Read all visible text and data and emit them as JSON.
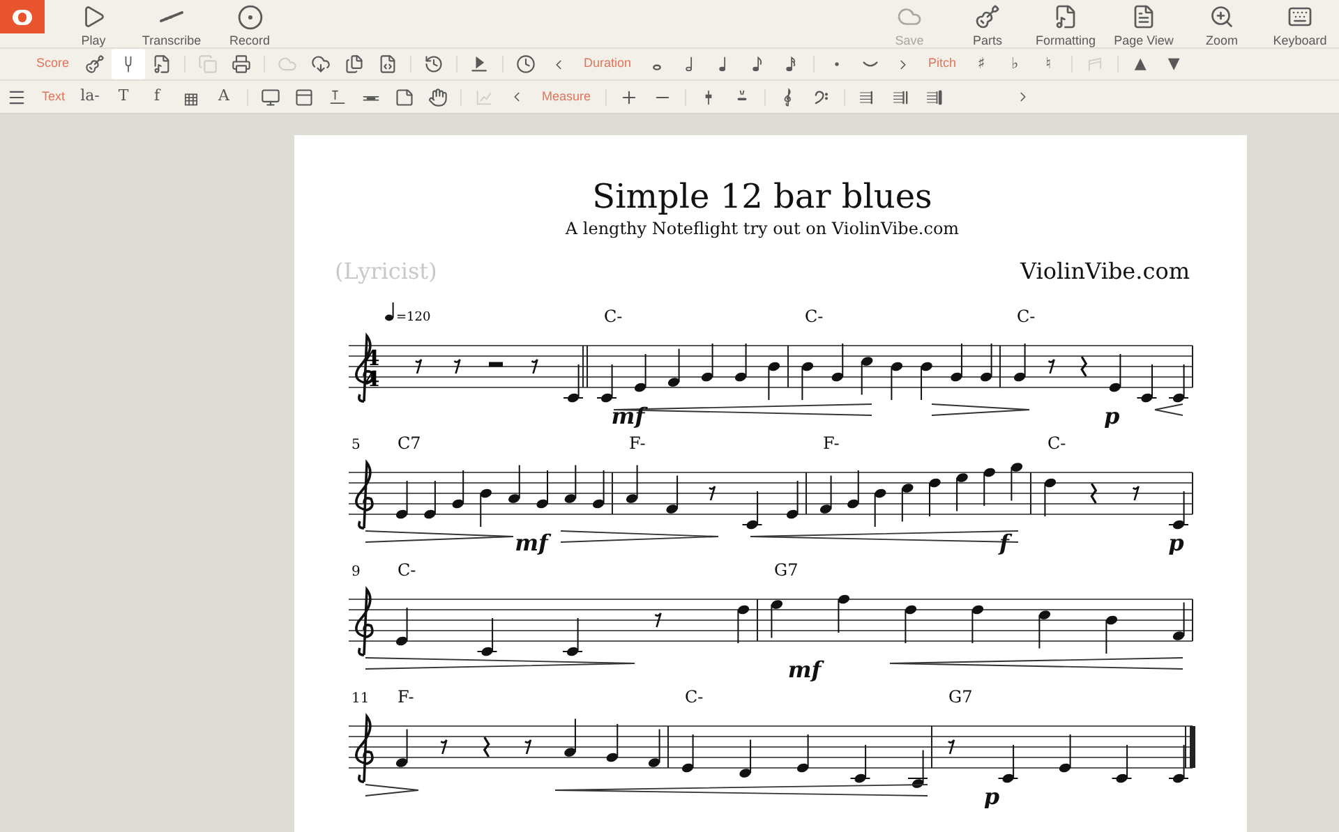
{
  "app_bar": {
    "left_items": [
      {
        "label": "Play",
        "disabled": false
      },
      {
        "label": "Transcribe",
        "disabled": false
      },
      {
        "label": "Record",
        "disabled": false
      }
    ],
    "right_items": [
      {
        "label": "Save",
        "disabled": true
      },
      {
        "label": "Parts",
        "disabled": false
      },
      {
        "label": "Formatting",
        "disabled": false
      },
      {
        "label": "Page View",
        "disabled": false
      },
      {
        "label": "Zoom",
        "disabled": false
      },
      {
        "label": "Keyboard",
        "disabled": false
      }
    ]
  },
  "toolbar_rows": [
    [
      {
        "kind": "label",
        "text": "Score"
      },
      {
        "kind": "icon",
        "selected": false,
        "disabled": false
      },
      {
        "kind": "icon",
        "selected": true,
        "disabled": false
      },
      {
        "kind": "icon",
        "selected": false,
        "disabled": false
      },
      {
        "kind": "separator"
      },
      {
        "kind": "icon",
        "selected": false,
        "disabled": true
      },
      {
        "kind": "icon",
        "selected": false,
        "disabled": false
      },
      {
        "kind": "separator"
      },
      {
        "kind": "icon",
        "selected": false,
        "disabled": true
      },
      {
        "kind": "icon",
        "selected": false,
        "disabled": false
      },
      {
        "kind": "icon",
        "selected": false,
        "disabled": false
      },
      {
        "kind": "icon",
        "selected": false,
        "disabled": false
      },
      {
        "kind": "separator"
      },
      {
        "kind": "icon",
        "selected": false,
        "disabled": false
      },
      {
        "kind": "separator"
      },
      {
        "kind": "icon",
        "selected": false,
        "disabled": false
      },
      {
        "kind": "separator"
      },
      {
        "kind": "icon",
        "selected": false,
        "disabled": false
      },
      {
        "kind": "icon",
        "selected": false,
        "disabled": false
      },
      {
        "kind": "label",
        "text": "Duration"
      },
      {
        "kind": "icon",
        "selected": false,
        "disabled": false
      },
      {
        "kind": "icon",
        "selected": false,
        "disabled": false
      },
      {
        "kind": "icon",
        "selected": false,
        "disabled": false
      },
      {
        "kind": "icon",
        "selected": false,
        "disabled": false
      },
      {
        "kind": "icon",
        "selected": false,
        "disabled": false
      },
      {
        "kind": "separator"
      },
      {
        "kind": "icon",
        "selected": false,
        "disabled": false
      },
      {
        "kind": "icon",
        "selected": false,
        "disabled": false
      },
      {
        "kind": "icon",
        "selected": false,
        "disabled": false
      },
      {
        "kind": "label",
        "text": "Pitch"
      },
      {
        "kind": "glyph",
        "text": "♯",
        "selected": false,
        "disabled": false
      },
      {
        "kind": "glyph",
        "text": "♭",
        "selected": false,
        "disabled": false
      },
      {
        "kind": "glyph",
        "text": "♮",
        "selected": false,
        "disabled": false
      },
      {
        "kind": "separator"
      },
      {
        "kind": "icon",
        "selected": false,
        "disabled": true
      },
      {
        "kind": "separator"
      },
      {
        "kind": "glyph",
        "text": "▲",
        "selected": false,
        "disabled": false
      },
      {
        "kind": "glyph",
        "text": "▼",
        "selected": false,
        "disabled": false
      }
    ],
    [
      {
        "kind": "icon",
        "selected": false,
        "disabled": false
      },
      {
        "kind": "label",
        "text": "Text"
      },
      {
        "kind": "glyph",
        "text": "la-",
        "selected": false,
        "disabled": false
      },
      {
        "kind": "glyph",
        "text": "T",
        "selected": false,
        "disabled": false
      },
      {
        "kind": "glyph",
        "text": "f",
        "selected": false,
        "disabled": false
      },
      {
        "kind": "icon",
        "selected": false,
        "disabled": false
      },
      {
        "kind": "glyph",
        "text": "A",
        "selected": false,
        "disabled": false
      },
      {
        "kind": "separator"
      },
      {
        "kind": "icon",
        "selected": false,
        "disabled": false
      },
      {
        "kind": "icon",
        "selected": false,
        "disabled": false
      },
      {
        "kind": "icon",
        "selected": false,
        "disabled": false
      },
      {
        "kind": "icon",
        "selected": false,
        "disabled": false
      },
      {
        "kind": "icon",
        "selected": false,
        "disabled": false
      },
      {
        "kind": "icon",
        "selected": false,
        "disabled": false
      },
      {
        "kind": "separator"
      },
      {
        "kind": "icon",
        "selected": false,
        "disabled": true
      },
      {
        "kind": "icon",
        "selected": false,
        "disabled": false
      },
      {
        "kind": "label",
        "text": "Measure"
      },
      {
        "kind": "separator"
      },
      {
        "kind": "icon",
        "selected": false,
        "disabled": false
      },
      {
        "kind": "icon",
        "selected": false,
        "disabled": false
      },
      {
        "kind": "separator"
      },
      {
        "kind": "icon",
        "selected": false,
        "disabled": false
      },
      {
        "kind": "icon",
        "selected": false,
        "disabled": false
      },
      {
        "kind": "separator"
      },
      {
        "kind": "icon",
        "selected": false,
        "disabled": false
      },
      {
        "kind": "icon",
        "selected": false,
        "disabled": false
      },
      {
        "kind": "separator"
      },
      {
        "kind": "icon",
        "selected": false,
        "disabled": false
      },
      {
        "kind": "icon",
        "selected": false,
        "disabled": false
      },
      {
        "kind": "icon",
        "selected": false,
        "disabled": false
      },
      {
        "kind": "spacer"
      },
      {
        "kind": "icon",
        "selected": false,
        "disabled": false
      }
    ]
  ],
  "score": {
    "title": "Simple 12 bar blues",
    "subtitle": "A lengthy Noteflight try out on ViolinVibe.com",
    "lyricist": "(Lyricist)",
    "composer": "ViolinVibe.com",
    "tempo": "=120",
    "time_signature": [
      "4",
      "4"
    ],
    "systems": [
      {
        "measures": [
          {
            "chord": "C-",
            "dynamics": [
              "mf"
            ]
          },
          {
            "chord": "C-"
          },
          {
            "chord": "C-",
            "dynamics": [
              "p"
            ]
          }
        ]
      },
      {
        "number": "5",
        "measures": [
          {
            "chord": "C7",
            "dynamics": [
              "mf"
            ]
          },
          {
            "chord": "F-"
          },
          {
            "chord": "F-",
            "dynamics": [
              "f"
            ]
          },
          {
            "chord": "C-",
            "dynamics": [
              "p"
            ]
          }
        ]
      },
      {
        "number": "9",
        "measures": [
          {
            "chord": "C-"
          },
          {
            "chord": "G7",
            "dynamics": [
              "mf"
            ]
          }
        ]
      },
      {
        "number": "11",
        "measures": [
          {
            "chord": "F-"
          },
          {
            "chord": "C-"
          },
          {
            "chord": "G7",
            "dynamics": [
              "p"
            ]
          }
        ]
      }
    ]
  }
}
